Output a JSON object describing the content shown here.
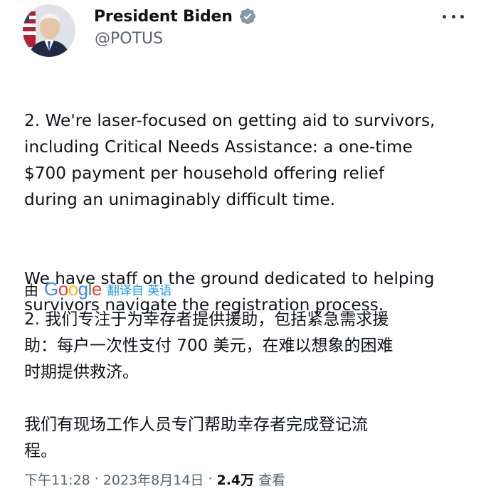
{
  "author": {
    "name": "President Biden",
    "handle": "@POTUS",
    "verified": true,
    "avatar_icon": "avatar-photo"
  },
  "tweet": {
    "paragraphs_en": [
      "2. We're laser-focused on getting aid to survivors,\nincluding Critical Needs Assistance: a one-time\n$700 payment per household offering relief\nduring an unimaginably difficult time.",
      "We have staff on the ground dedicated to helping\nsurvivors navigate the registration process."
    ],
    "translation": {
      "by_label": "由",
      "provider": "Google",
      "translated_from": "翻译自 英语"
    },
    "paragraphs_zh": [
      "2. 我们专注于为幸存者提供援助，包括紧急需求援\n助：每户一次性支付 700 美元，在难以想象的困难\n时期提供救济。",
      "我们有现场工作人员专门帮助幸存者完成登记流\n程。"
    ]
  },
  "meta": {
    "time": "下午11:28",
    "date": "2023年8月14日",
    "views_count": "2.4万",
    "views_label": "查看"
  },
  "colors": {
    "verified_badge": "#829aab",
    "link_blue": "#1d9bf0",
    "text": "#0f1419",
    "secondary_text": "#536471",
    "google_blue": "#4285F4",
    "google_red": "#EA4335",
    "google_yellow": "#FBBC05",
    "google_green": "#34A853"
  }
}
